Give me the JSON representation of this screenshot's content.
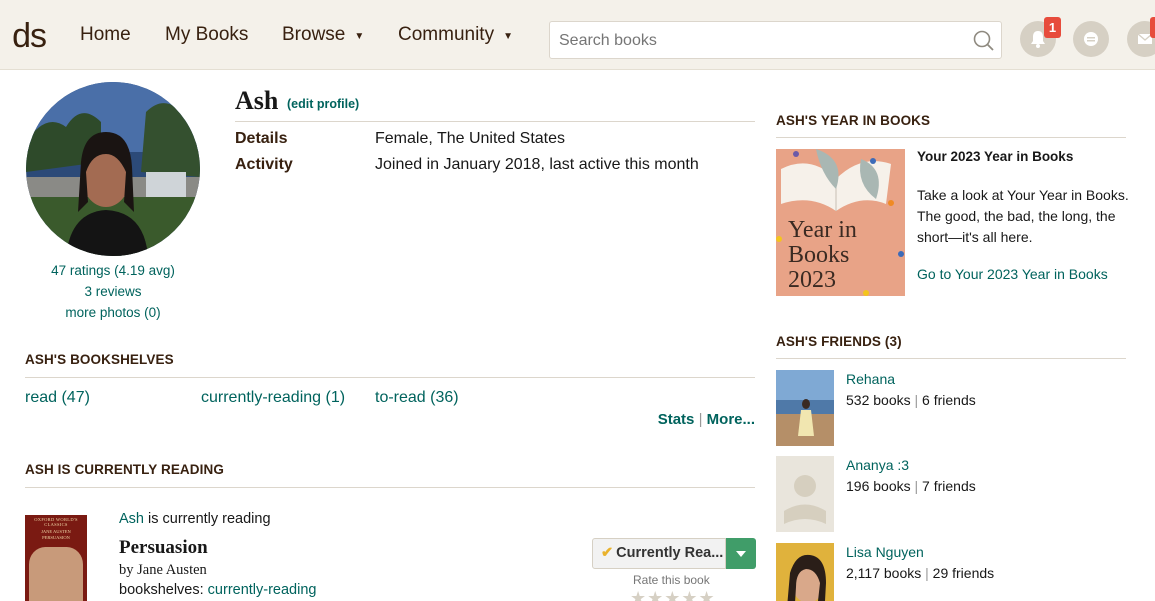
{
  "header": {
    "logo_text": "ds",
    "nav": {
      "home": "Home",
      "my_books": "My Books",
      "browse": "Browse",
      "community": "Community"
    },
    "search": {
      "placeholder": "Search books"
    },
    "notifications": {
      "count": "1"
    }
  },
  "profile": {
    "name": "Ash",
    "edit_link": "(edit profile)",
    "details_label": "Details",
    "details_value": "Female, The United States",
    "activity_label": "Activity",
    "activity_value": "Joined in January 2018, last active this month",
    "ratings": "47 ratings (4.19 avg)",
    "reviews": "3 reviews",
    "photos": "more photos (0)"
  },
  "bookshelves": {
    "heading": "ASH'S BOOKSHELVES",
    "shelves": [
      "read (47)",
      "currently-reading (1)",
      "to-read (36)"
    ],
    "stats": "Stats",
    "separator": "|",
    "more": "More..."
  },
  "currently_reading": {
    "heading": "ASH IS CURRENTLY READING",
    "user": "Ash",
    "user_suffix": " is currently reading",
    "title": "Persuasion",
    "author": "by Jane Austen",
    "shelves_label": "bookshelves: ",
    "shelf": "currently-reading",
    "button": "Currently Rea...",
    "rate_label": "Rate this book",
    "stars": "★★★★★",
    "cover_series": "OXFORD WORLD'S CLASSICS",
    "cover_author": "JANE AUSTEN",
    "cover_title": "PERSUASION"
  },
  "year_in_books": {
    "heading": "ASH'S YEAR IN BOOKS",
    "image_text": [
      "Year in",
      "Books",
      "2023"
    ],
    "title": "Your 2023 Year in Books",
    "description": "Take a look at Your Year in Books. The good, the bad, the long, the short—it's all here.",
    "link": "Go to Your 2023 Year in Books"
  },
  "friends": {
    "heading": "ASH'S FRIENDS (3)",
    "separator": "|",
    "list": [
      {
        "name": "Rehana",
        "books": "532 books",
        "friends": "6 friends"
      },
      {
        "name": "Ananya :3",
        "books": "196 books",
        "friends": "7 friends"
      },
      {
        "name": "Lisa Nguyen",
        "books": "2,117 books",
        "friends": "29 friends"
      }
    ]
  },
  "colors": {
    "header_bg": "#f4f1ea",
    "link": "#00635d",
    "heading": "#382110",
    "button_green": "#409d69",
    "badge_red": "#e74c3c"
  }
}
